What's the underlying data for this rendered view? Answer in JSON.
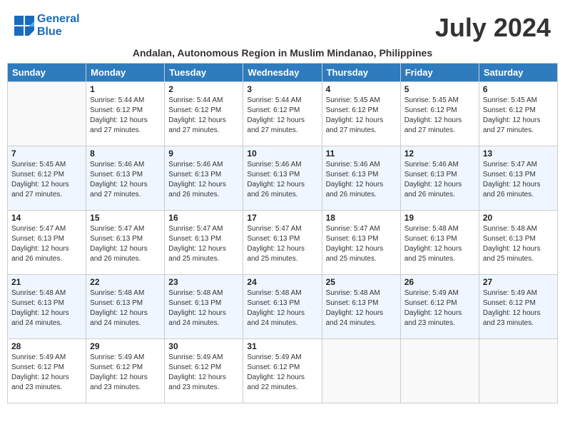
{
  "header": {
    "logo_line1": "General",
    "logo_line2": "Blue",
    "month_title": "July 2024",
    "subtitle": "Andalan, Autonomous Region in Muslim Mindanao, Philippines"
  },
  "weekdays": [
    "Sunday",
    "Monday",
    "Tuesday",
    "Wednesday",
    "Thursday",
    "Friday",
    "Saturday"
  ],
  "weeks": [
    [
      {
        "day": "",
        "info": ""
      },
      {
        "day": "1",
        "info": "Sunrise: 5:44 AM\nSunset: 6:12 PM\nDaylight: 12 hours\nand 27 minutes."
      },
      {
        "day": "2",
        "info": "Sunrise: 5:44 AM\nSunset: 6:12 PM\nDaylight: 12 hours\nand 27 minutes."
      },
      {
        "day": "3",
        "info": "Sunrise: 5:44 AM\nSunset: 6:12 PM\nDaylight: 12 hours\nand 27 minutes."
      },
      {
        "day": "4",
        "info": "Sunrise: 5:45 AM\nSunset: 6:12 PM\nDaylight: 12 hours\nand 27 minutes."
      },
      {
        "day": "5",
        "info": "Sunrise: 5:45 AM\nSunset: 6:12 PM\nDaylight: 12 hours\nand 27 minutes."
      },
      {
        "day": "6",
        "info": "Sunrise: 5:45 AM\nSunset: 6:12 PM\nDaylight: 12 hours\nand 27 minutes."
      }
    ],
    [
      {
        "day": "7",
        "info": "Sunrise: 5:45 AM\nSunset: 6:12 PM\nDaylight: 12 hours\nand 27 minutes."
      },
      {
        "day": "8",
        "info": "Sunrise: 5:46 AM\nSunset: 6:13 PM\nDaylight: 12 hours\nand 27 minutes."
      },
      {
        "day": "9",
        "info": "Sunrise: 5:46 AM\nSunset: 6:13 PM\nDaylight: 12 hours\nand 26 minutes."
      },
      {
        "day": "10",
        "info": "Sunrise: 5:46 AM\nSunset: 6:13 PM\nDaylight: 12 hours\nand 26 minutes."
      },
      {
        "day": "11",
        "info": "Sunrise: 5:46 AM\nSunset: 6:13 PM\nDaylight: 12 hours\nand 26 minutes."
      },
      {
        "day": "12",
        "info": "Sunrise: 5:46 AM\nSunset: 6:13 PM\nDaylight: 12 hours\nand 26 minutes."
      },
      {
        "day": "13",
        "info": "Sunrise: 5:47 AM\nSunset: 6:13 PM\nDaylight: 12 hours\nand 26 minutes."
      }
    ],
    [
      {
        "day": "14",
        "info": "Sunrise: 5:47 AM\nSunset: 6:13 PM\nDaylight: 12 hours\nand 26 minutes."
      },
      {
        "day": "15",
        "info": "Sunrise: 5:47 AM\nSunset: 6:13 PM\nDaylight: 12 hours\nand 26 minutes."
      },
      {
        "day": "16",
        "info": "Sunrise: 5:47 AM\nSunset: 6:13 PM\nDaylight: 12 hours\nand 25 minutes."
      },
      {
        "day": "17",
        "info": "Sunrise: 5:47 AM\nSunset: 6:13 PM\nDaylight: 12 hours\nand 25 minutes."
      },
      {
        "day": "18",
        "info": "Sunrise: 5:47 AM\nSunset: 6:13 PM\nDaylight: 12 hours\nand 25 minutes."
      },
      {
        "day": "19",
        "info": "Sunrise: 5:48 AM\nSunset: 6:13 PM\nDaylight: 12 hours\nand 25 minutes."
      },
      {
        "day": "20",
        "info": "Sunrise: 5:48 AM\nSunset: 6:13 PM\nDaylight: 12 hours\nand 25 minutes."
      }
    ],
    [
      {
        "day": "21",
        "info": "Sunrise: 5:48 AM\nSunset: 6:13 PM\nDaylight: 12 hours\nand 24 minutes."
      },
      {
        "day": "22",
        "info": "Sunrise: 5:48 AM\nSunset: 6:13 PM\nDaylight: 12 hours\nand 24 minutes."
      },
      {
        "day": "23",
        "info": "Sunrise: 5:48 AM\nSunset: 6:13 PM\nDaylight: 12 hours\nand 24 minutes."
      },
      {
        "day": "24",
        "info": "Sunrise: 5:48 AM\nSunset: 6:13 PM\nDaylight: 12 hours\nand 24 minutes."
      },
      {
        "day": "25",
        "info": "Sunrise: 5:48 AM\nSunset: 6:13 PM\nDaylight: 12 hours\nand 24 minutes."
      },
      {
        "day": "26",
        "info": "Sunrise: 5:49 AM\nSunset: 6:12 PM\nDaylight: 12 hours\nand 23 minutes."
      },
      {
        "day": "27",
        "info": "Sunrise: 5:49 AM\nSunset: 6:12 PM\nDaylight: 12 hours\nand 23 minutes."
      }
    ],
    [
      {
        "day": "28",
        "info": "Sunrise: 5:49 AM\nSunset: 6:12 PM\nDaylight: 12 hours\nand 23 minutes."
      },
      {
        "day": "29",
        "info": "Sunrise: 5:49 AM\nSunset: 6:12 PM\nDaylight: 12 hours\nand 23 minutes."
      },
      {
        "day": "30",
        "info": "Sunrise: 5:49 AM\nSunset: 6:12 PM\nDaylight: 12 hours\nand 23 minutes."
      },
      {
        "day": "31",
        "info": "Sunrise: 5:49 AM\nSunset: 6:12 PM\nDaylight: 12 hours\nand 22 minutes."
      },
      {
        "day": "",
        "info": ""
      },
      {
        "day": "",
        "info": ""
      },
      {
        "day": "",
        "info": ""
      }
    ]
  ]
}
